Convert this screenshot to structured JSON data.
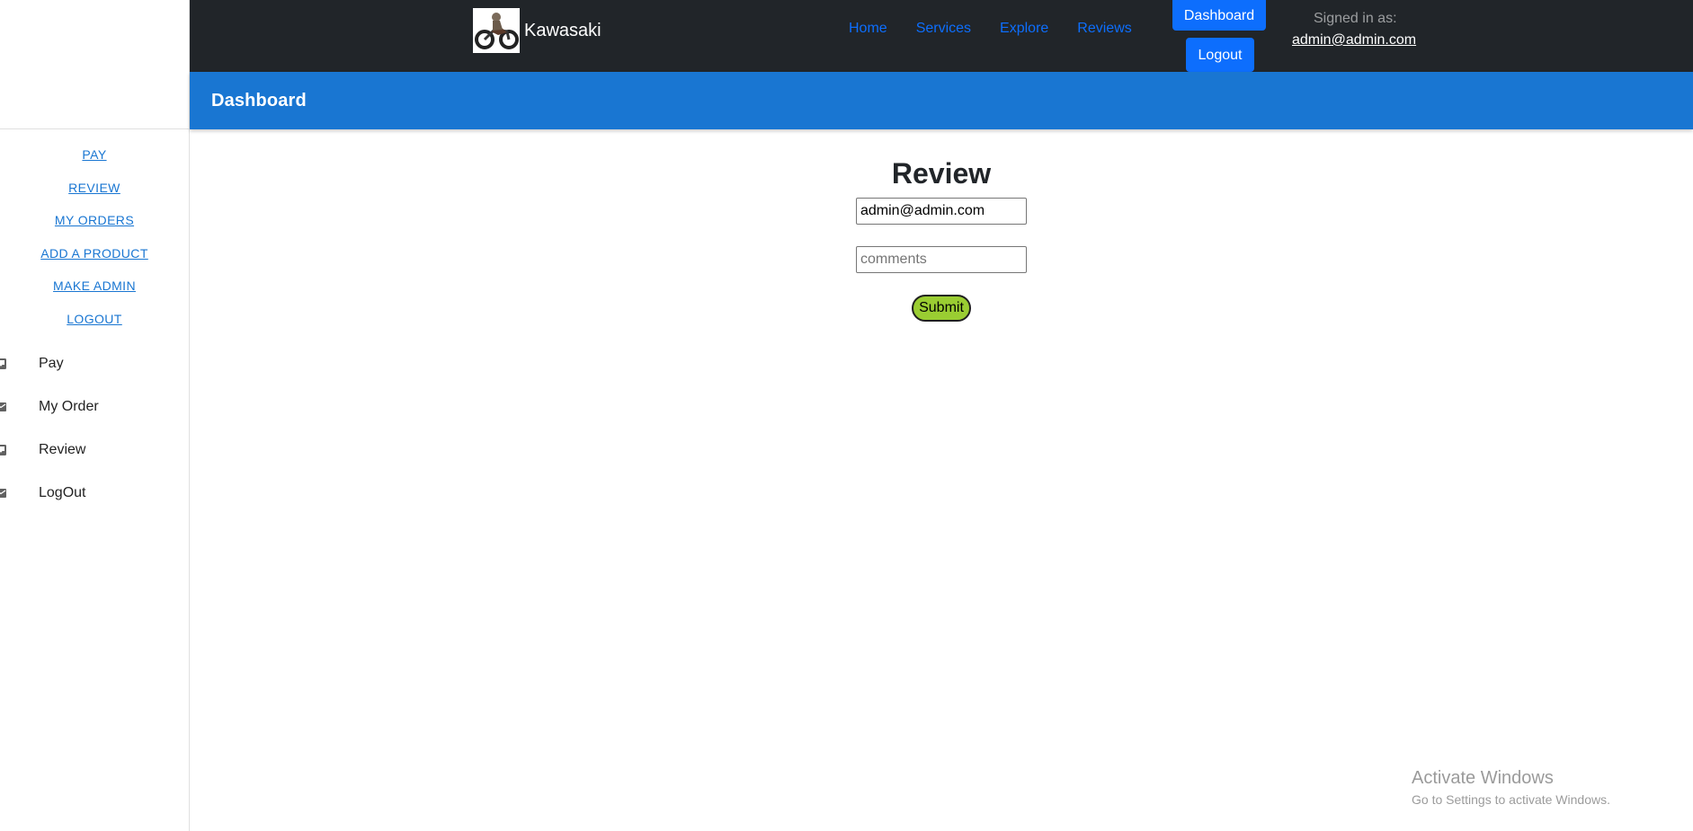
{
  "sidebar": {
    "links": [
      {
        "label": "PAY"
      },
      {
        "label": "REVIEW"
      },
      {
        "label": "MY ORDERS"
      },
      {
        "label": "ADD A PRODUCT"
      },
      {
        "label": "MAKE ADMIN"
      },
      {
        "label": "LOGOUT"
      }
    ],
    "items": [
      {
        "label": "Pay",
        "icon": "inbox-icon"
      },
      {
        "label": "My Order",
        "icon": "mail-icon"
      },
      {
        "label": "Review",
        "icon": "inbox-icon"
      },
      {
        "label": "LogOut",
        "icon": "mail-icon"
      }
    ]
  },
  "navbar": {
    "brand": "Kawasaki",
    "logo_icon": "motorcycle-logo",
    "links": [
      {
        "label": "Home"
      },
      {
        "label": "Services"
      },
      {
        "label": "Explore"
      },
      {
        "label": "Reviews"
      }
    ],
    "dashboard_label": "Dashboard",
    "logout_label": "Logout",
    "signed_in_label": "Signed in as:",
    "signed_in_email": "admin@admin.com"
  },
  "appbar": {
    "title": "Dashboard"
  },
  "review": {
    "title": "Review",
    "email_value": "admin@admin.com",
    "comments_placeholder": "comments",
    "submit_label": "Submit"
  },
  "watermark": {
    "title": "Activate Windows",
    "subtitle": "Go to Settings to activate Windows."
  },
  "colors": {
    "navbar_bg": "#212529",
    "appbar_bg": "#1976d2",
    "link_blue": "#0d6efd",
    "submit_bg": "#9acd32"
  }
}
